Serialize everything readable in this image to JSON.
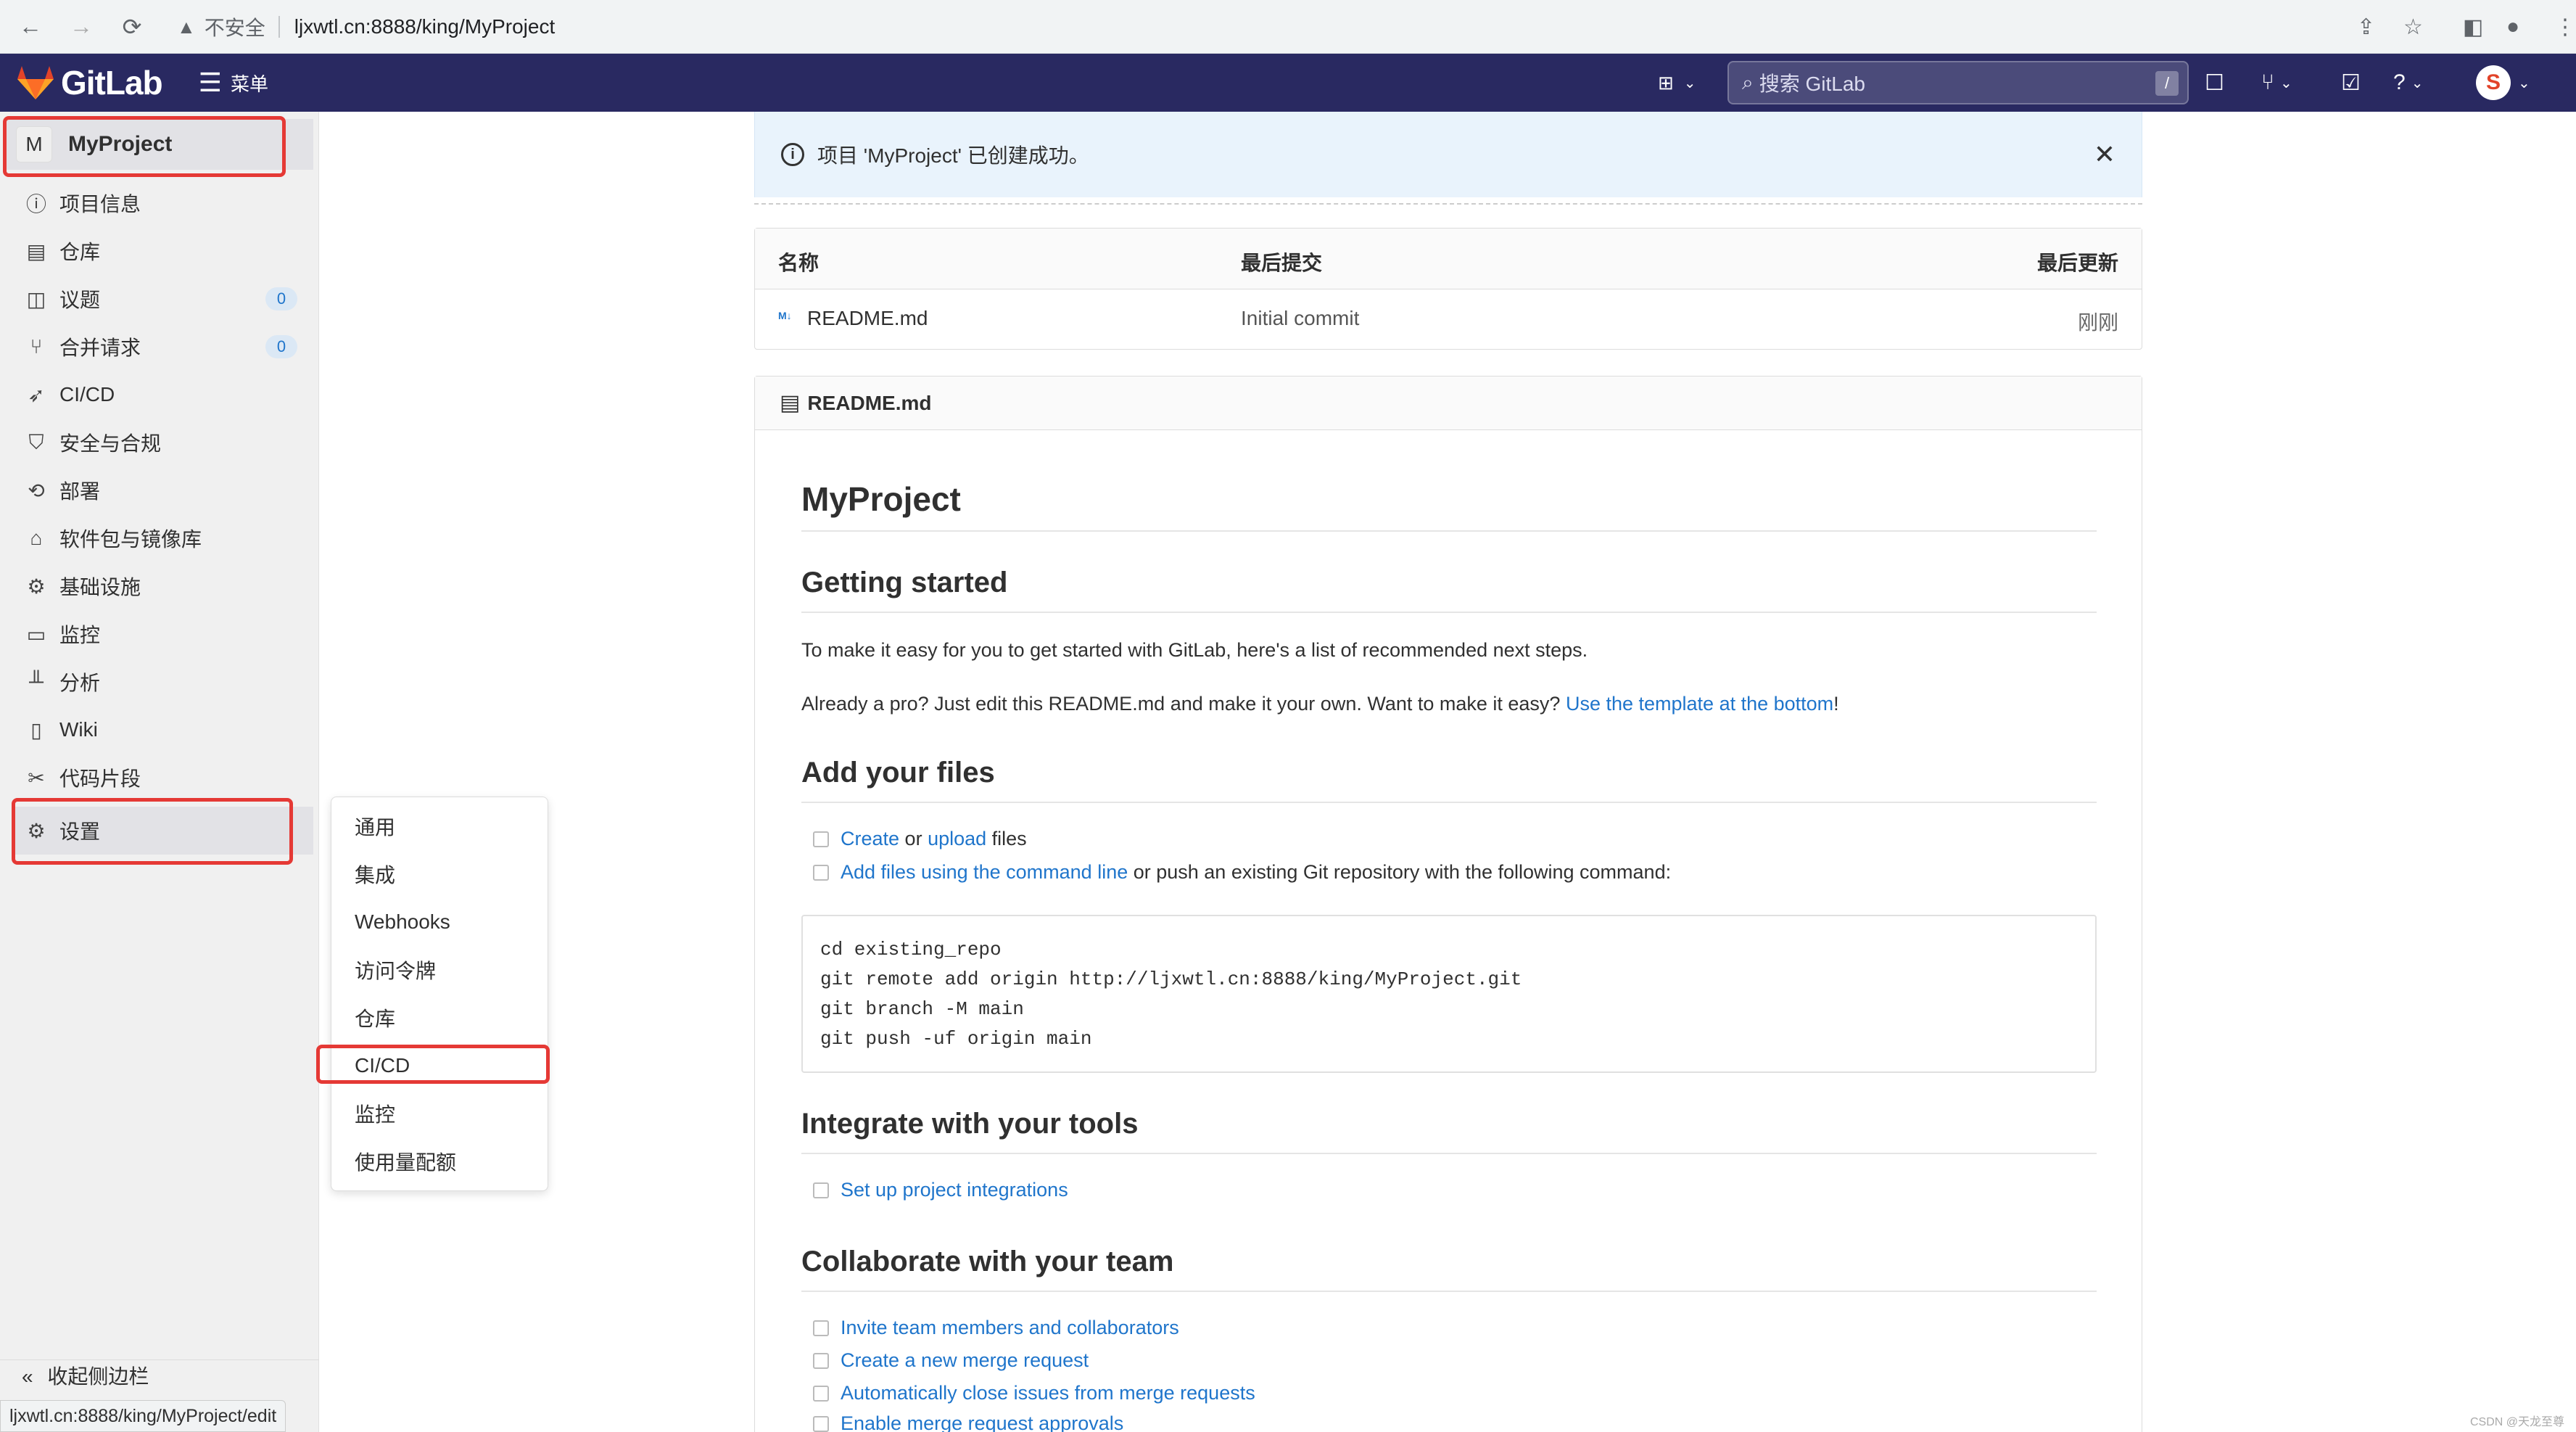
{
  "browser": {
    "insecure_label": "不安全",
    "url": "ljxwtl.cn:8888/king/MyProject",
    "status_url": "ljxwtl.cn:8888/king/MyProject/edit"
  },
  "header": {
    "logo_text": "GitLab",
    "menu_label": "菜单",
    "search_placeholder": "搜索 GitLab",
    "search_shortcut": "/",
    "avatar_letter": "S"
  },
  "sidebar": {
    "project_initial": "M",
    "project_name": "MyProject",
    "items": [
      {
        "label": "项目信息",
        "icon": "info-icon"
      },
      {
        "label": "仓库",
        "icon": "doc-icon"
      },
      {
        "label": "议题",
        "icon": "issues-icon",
        "badge": "0"
      },
      {
        "label": "合并请求",
        "icon": "merge-request-icon",
        "badge": "0"
      },
      {
        "label": "CI/CD",
        "icon": "rocket-icon"
      },
      {
        "label": "安全与合规",
        "icon": "shield-icon"
      },
      {
        "label": "部署",
        "icon": "deploy-icon"
      },
      {
        "label": "软件包与镜像库",
        "icon": "package-icon"
      },
      {
        "label": "基础设施",
        "icon": "cloud-gear-icon"
      },
      {
        "label": "监控",
        "icon": "monitor-icon"
      },
      {
        "label": "分析",
        "icon": "chart-icon"
      },
      {
        "label": "Wiki",
        "icon": "book-icon"
      },
      {
        "label": "代码片段",
        "icon": "scissors-icon"
      },
      {
        "label": "设置",
        "icon": "gear-icon"
      }
    ],
    "collapse_label": "收起侧边栏"
  },
  "settings_menu": {
    "items": [
      "通用",
      "集成",
      "Webhooks",
      "访问令牌",
      "仓库",
      "CI/CD",
      "监控",
      "使用量配额"
    ]
  },
  "alert": {
    "message": "项目 'MyProject' 已创建成功。"
  },
  "file_table": {
    "headers": [
      "名称",
      "最后提交",
      "最后更新"
    ],
    "rows": [
      {
        "name": "README.md",
        "commit": "Initial commit",
        "updated": "刚刚"
      }
    ]
  },
  "readme": {
    "file_name": "README.md",
    "h1": "MyProject",
    "getting_started": "Getting started",
    "intro": "To make it easy for you to get started with GitLab, here's a list of recommended next steps.",
    "pro_prefix": "Already a pro? Just edit this README.md and make it your own. Want to make it easy? ",
    "pro_link": "Use the template at the bottom",
    "pro_suffix": "!",
    "add_files": "Add your files",
    "create_link": "Create",
    "or_text": " or ",
    "upload_link": "upload",
    "files_text": " files",
    "cmdline_link": "Add files using the command line",
    "cmdline_suffix": " or push an existing Git repository with the following command:",
    "code": [
      "cd existing_repo",
      "git remote add origin http://ljxwtl.cn:8888/king/MyProject.git",
      "git branch -M main",
      "git push -uf origin main"
    ],
    "integrate": "Integrate with your tools",
    "integrations_link": "Set up project integrations",
    "collaborate": "Collaborate with your team",
    "collab_links": [
      "Invite team members and collaborators",
      "Create a new merge request",
      "Automatically close issues from merge requests",
      "Enable merge request approvals"
    ]
  },
  "watermark": "CSDN @天龙至尊",
  "colors": {
    "header_bg": "#292961",
    "link": "#1f75cb",
    "highlight_border": "#e53935",
    "alert_bg": "#e9f3fc"
  }
}
